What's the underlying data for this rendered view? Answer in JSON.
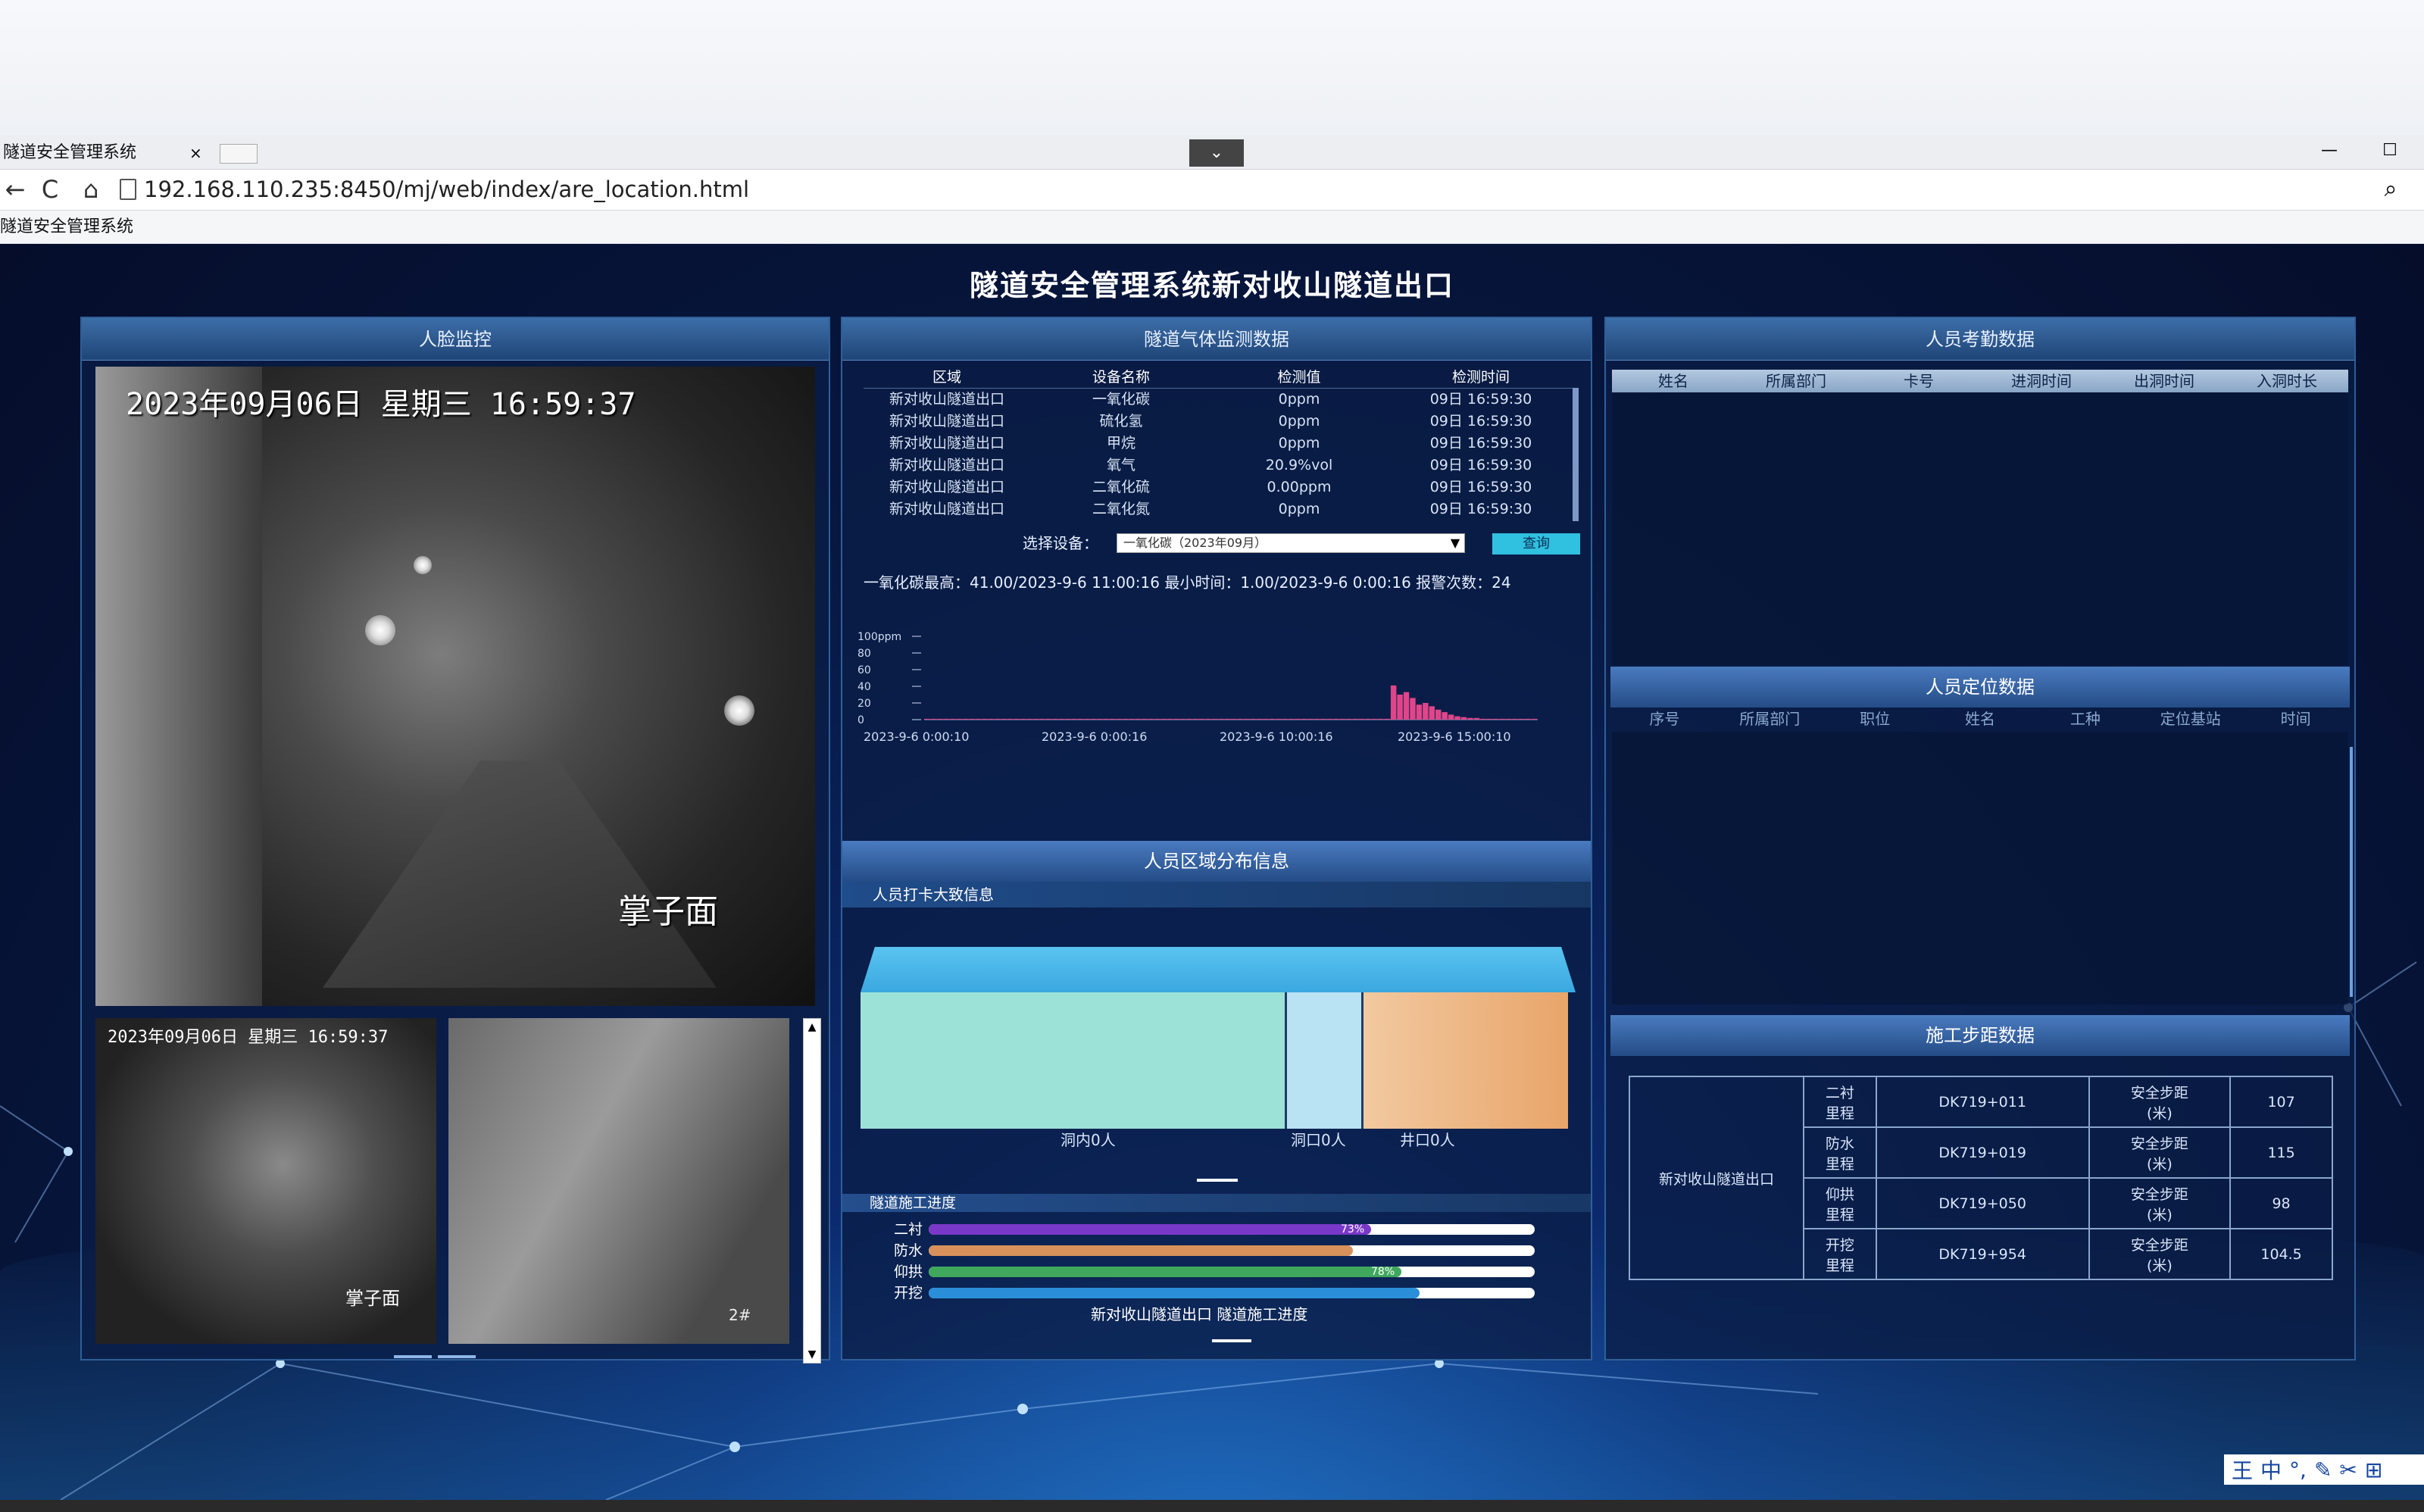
{
  "browser": {
    "tab_title": "隧道安全管理系统",
    "tab_close": "×",
    "dropdown": "⌄",
    "minimize": "—",
    "maximize": "☐",
    "back": "←",
    "reload": "C",
    "home": "⌂",
    "url": "192.168.110.235:8450/mj/web/index/are_location.html",
    "bookmark_1": "隧道安全管理系统"
  },
  "dashboard": {
    "title": "隧道安全管理系统新对收山隧道出口"
  },
  "left_panel": {
    "title": "人脸监控",
    "main_video": {
      "timestamp": "2023年09月06日 星期三 16:59:37",
      "label": "掌子面"
    },
    "video_2": {
      "timestamp": "2023年09月06日 星期三 16:59:37",
      "label": "掌子面"
    },
    "video_3": {
      "label": "2#"
    }
  },
  "gas_panel": {
    "title": "隧道气体监测数据",
    "columns": [
      "区域",
      "设备名称",
      "检测值",
      "检测时间"
    ],
    "rows": [
      [
        "新对收山隧道出口",
        "一氧化碳",
        "0ppm",
        "09日 16:59:30"
      ],
      [
        "新对收山隧道出口",
        "硫化氢",
        "0ppm",
        "09日 16:59:30"
      ],
      [
        "新对收山隧道出口",
        "甲烷",
        "0ppm",
        "09日 16:59:30"
      ],
      [
        "新对收山隧道出口",
        "氧气",
        "20.9%vol",
        "09日 16:59:30"
      ],
      [
        "新对收山隧道出口",
        "二氧化硫",
        "0.00ppm",
        "09日 16:59:30"
      ],
      [
        "新对收山隧道出口",
        "二氧化氮",
        "0ppm",
        "09日 16:59:30"
      ]
    ],
    "select_label": "选择设备：",
    "select_value": "一氧化碳（2023年09月）",
    "query_button": "查询",
    "stats": "一氧化碳最高：41.00/2023-9-6 11:00:16    最小时间：1.00/2023-9-6 0:00:16    报警次数：24"
  },
  "chart_data": {
    "type": "bar",
    "xlabel": "",
    "ylabel": "",
    "y_ticks": [
      "100ppm",
      "80",
      "60",
      "40",
      "20",
      "0"
    ],
    "x_ticks": [
      "2023-9-6 0:00:10",
      "2023-9-6 0:00:16",
      "2023-9-6 10:00:16",
      "2023-9-6 15:00:10"
    ],
    "values": [
      1,
      1,
      1,
      1,
      1,
      1,
      1,
      1,
      1,
      1,
      1,
      1,
      1,
      1,
      1,
      1,
      1,
      1,
      1,
      1,
      1,
      1,
      1,
      1,
      1,
      1,
      1,
      1,
      1,
      1,
      1,
      1,
      1,
      1,
      1,
      1,
      1,
      1,
      1,
      1,
      1,
      1,
      1,
      1,
      1,
      1,
      1,
      1,
      1,
      1,
      1,
      1,
      1,
      1,
      1,
      1,
      1,
      1,
      1,
      1,
      1,
      1,
      1,
      1,
      1,
      1,
      1,
      1,
      1,
      1,
      1,
      1,
      1,
      41,
      30,
      33,
      26,
      18,
      20,
      16,
      12,
      9,
      6,
      4,
      3,
      2,
      2,
      1,
      1,
      1,
      1,
      1,
      1,
      1,
      1,
      1
    ],
    "ylim": [
      0,
      100
    ],
    "color": "#e0458a"
  },
  "personnel_panel": {
    "title": "人员区域分布信息",
    "subtitle": "人员打卡大致信息",
    "segments": [
      {
        "label": "洞内0人",
        "value": 0,
        "color": "#9de2d6"
      },
      {
        "label": "洞口0人",
        "value": 0,
        "color": "#b9e2f3"
      },
      {
        "label": "井口0人",
        "value": 0,
        "color": "#e8a56a"
      }
    ]
  },
  "progress_panel": {
    "title": "隧道施工进度",
    "rows": [
      {
        "label": "二衬",
        "pct_text": "73%",
        "value": 0.73,
        "color": "#7a38c8"
      },
      {
        "label": "防水",
        "pct_text": "",
        "value": 0.7,
        "color": "#d8915a"
      },
      {
        "label": "仰拱",
        "pct_text": "78%",
        "value": 0.78,
        "color": "#3fa85c"
      },
      {
        "label": "开挖",
        "pct_text": "",
        "value": 0.81,
        "color": "#2a8fd8"
      }
    ],
    "caption": "新对收山隧道出口 隧道施工进度"
  },
  "right_panel": {
    "attendance_title": "人员考勤数据",
    "attendance_columns": [
      "姓名",
      "所属部门",
      "卡号",
      "进洞时间",
      "出洞时间",
      "入洞时长"
    ],
    "location_title": "人员定位数据",
    "location_columns": [
      "序号",
      "所属部门",
      "职位",
      "姓名",
      "工种",
      "定位基站",
      "时间"
    ],
    "distance_title": "施工步距数据",
    "distance_area": "新对收山隧道出口",
    "distance_rows": [
      [
        "二衬\n里程",
        "DK719+011",
        "安全步距\n(米)",
        "107"
      ],
      [
        "防水\n里程",
        "DK719+019",
        "安全步距\n(米)",
        "115"
      ],
      [
        "仰拱\n里程",
        "DK719+050",
        "安全步距\n(米)",
        "98"
      ],
      [
        "开挖\n里程",
        "DK719+954",
        "安全步距\n(米)",
        "104.5"
      ]
    ]
  },
  "ime": {
    "label_1": "王",
    "label_2": "中",
    "label_3": "°,",
    "label_4": "✎",
    "label_5": "✂",
    "label_6": "⊞"
  }
}
